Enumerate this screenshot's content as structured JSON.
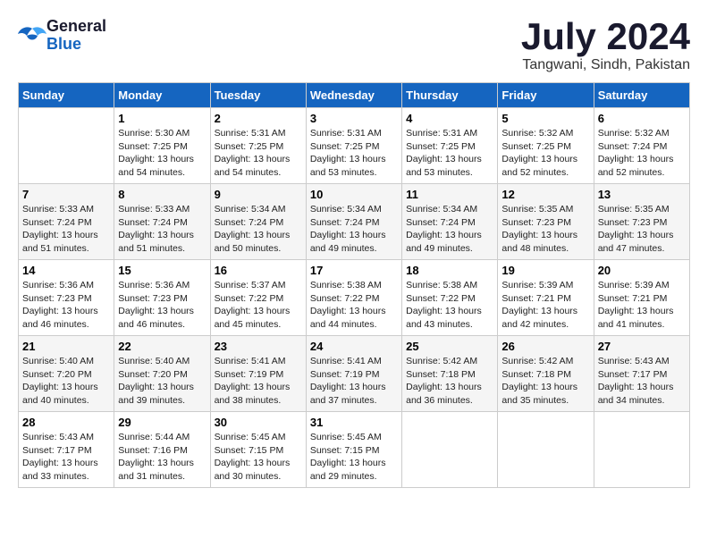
{
  "logo": {
    "line1": "General",
    "line2": "Blue"
  },
  "title": "July 2024",
  "location": "Tangwani, Sindh, Pakistan",
  "days_of_week": [
    "Sunday",
    "Monday",
    "Tuesday",
    "Wednesday",
    "Thursday",
    "Friday",
    "Saturday"
  ],
  "weeks": [
    [
      {
        "day": "",
        "sunrise": "",
        "sunset": "",
        "daylight": ""
      },
      {
        "day": "1",
        "sunrise": "Sunrise: 5:30 AM",
        "sunset": "Sunset: 7:25 PM",
        "daylight": "Daylight: 13 hours and 54 minutes."
      },
      {
        "day": "2",
        "sunrise": "Sunrise: 5:31 AM",
        "sunset": "Sunset: 7:25 PM",
        "daylight": "Daylight: 13 hours and 54 minutes."
      },
      {
        "day": "3",
        "sunrise": "Sunrise: 5:31 AM",
        "sunset": "Sunset: 7:25 PM",
        "daylight": "Daylight: 13 hours and 53 minutes."
      },
      {
        "day": "4",
        "sunrise": "Sunrise: 5:31 AM",
        "sunset": "Sunset: 7:25 PM",
        "daylight": "Daylight: 13 hours and 53 minutes."
      },
      {
        "day": "5",
        "sunrise": "Sunrise: 5:32 AM",
        "sunset": "Sunset: 7:25 PM",
        "daylight": "Daylight: 13 hours and 52 minutes."
      },
      {
        "day": "6",
        "sunrise": "Sunrise: 5:32 AM",
        "sunset": "Sunset: 7:24 PM",
        "daylight": "Daylight: 13 hours and 52 minutes."
      }
    ],
    [
      {
        "day": "7",
        "sunrise": "Sunrise: 5:33 AM",
        "sunset": "Sunset: 7:24 PM",
        "daylight": "Daylight: 13 hours and 51 minutes."
      },
      {
        "day": "8",
        "sunrise": "Sunrise: 5:33 AM",
        "sunset": "Sunset: 7:24 PM",
        "daylight": "Daylight: 13 hours and 51 minutes."
      },
      {
        "day": "9",
        "sunrise": "Sunrise: 5:34 AM",
        "sunset": "Sunset: 7:24 PM",
        "daylight": "Daylight: 13 hours and 50 minutes."
      },
      {
        "day": "10",
        "sunrise": "Sunrise: 5:34 AM",
        "sunset": "Sunset: 7:24 PM",
        "daylight": "Daylight: 13 hours and 49 minutes."
      },
      {
        "day": "11",
        "sunrise": "Sunrise: 5:34 AM",
        "sunset": "Sunset: 7:24 PM",
        "daylight": "Daylight: 13 hours and 49 minutes."
      },
      {
        "day": "12",
        "sunrise": "Sunrise: 5:35 AM",
        "sunset": "Sunset: 7:23 PM",
        "daylight": "Daylight: 13 hours and 48 minutes."
      },
      {
        "day": "13",
        "sunrise": "Sunrise: 5:35 AM",
        "sunset": "Sunset: 7:23 PM",
        "daylight": "Daylight: 13 hours and 47 minutes."
      }
    ],
    [
      {
        "day": "14",
        "sunrise": "Sunrise: 5:36 AM",
        "sunset": "Sunset: 7:23 PM",
        "daylight": "Daylight: 13 hours and 46 minutes."
      },
      {
        "day": "15",
        "sunrise": "Sunrise: 5:36 AM",
        "sunset": "Sunset: 7:23 PM",
        "daylight": "Daylight: 13 hours and 46 minutes."
      },
      {
        "day": "16",
        "sunrise": "Sunrise: 5:37 AM",
        "sunset": "Sunset: 7:22 PM",
        "daylight": "Daylight: 13 hours and 45 minutes."
      },
      {
        "day": "17",
        "sunrise": "Sunrise: 5:38 AM",
        "sunset": "Sunset: 7:22 PM",
        "daylight": "Daylight: 13 hours and 44 minutes."
      },
      {
        "day": "18",
        "sunrise": "Sunrise: 5:38 AM",
        "sunset": "Sunset: 7:22 PM",
        "daylight": "Daylight: 13 hours and 43 minutes."
      },
      {
        "day": "19",
        "sunrise": "Sunrise: 5:39 AM",
        "sunset": "Sunset: 7:21 PM",
        "daylight": "Daylight: 13 hours and 42 minutes."
      },
      {
        "day": "20",
        "sunrise": "Sunrise: 5:39 AM",
        "sunset": "Sunset: 7:21 PM",
        "daylight": "Daylight: 13 hours and 41 minutes."
      }
    ],
    [
      {
        "day": "21",
        "sunrise": "Sunrise: 5:40 AM",
        "sunset": "Sunset: 7:20 PM",
        "daylight": "Daylight: 13 hours and 40 minutes."
      },
      {
        "day": "22",
        "sunrise": "Sunrise: 5:40 AM",
        "sunset": "Sunset: 7:20 PM",
        "daylight": "Daylight: 13 hours and 39 minutes."
      },
      {
        "day": "23",
        "sunrise": "Sunrise: 5:41 AM",
        "sunset": "Sunset: 7:19 PM",
        "daylight": "Daylight: 13 hours and 38 minutes."
      },
      {
        "day": "24",
        "sunrise": "Sunrise: 5:41 AM",
        "sunset": "Sunset: 7:19 PM",
        "daylight": "Daylight: 13 hours and 37 minutes."
      },
      {
        "day": "25",
        "sunrise": "Sunrise: 5:42 AM",
        "sunset": "Sunset: 7:18 PM",
        "daylight": "Daylight: 13 hours and 36 minutes."
      },
      {
        "day": "26",
        "sunrise": "Sunrise: 5:42 AM",
        "sunset": "Sunset: 7:18 PM",
        "daylight": "Daylight: 13 hours and 35 minutes."
      },
      {
        "day": "27",
        "sunrise": "Sunrise: 5:43 AM",
        "sunset": "Sunset: 7:17 PM",
        "daylight": "Daylight: 13 hours and 34 minutes."
      }
    ],
    [
      {
        "day": "28",
        "sunrise": "Sunrise: 5:43 AM",
        "sunset": "Sunset: 7:17 PM",
        "daylight": "Daylight: 13 hours and 33 minutes."
      },
      {
        "day": "29",
        "sunrise": "Sunrise: 5:44 AM",
        "sunset": "Sunset: 7:16 PM",
        "daylight": "Daylight: 13 hours and 31 minutes."
      },
      {
        "day": "30",
        "sunrise": "Sunrise: 5:45 AM",
        "sunset": "Sunset: 7:15 PM",
        "daylight": "Daylight: 13 hours and 30 minutes."
      },
      {
        "day": "31",
        "sunrise": "Sunrise: 5:45 AM",
        "sunset": "Sunset: 7:15 PM",
        "daylight": "Daylight: 13 hours and 29 minutes."
      },
      {
        "day": "",
        "sunrise": "",
        "sunset": "",
        "daylight": ""
      },
      {
        "day": "",
        "sunrise": "",
        "sunset": "",
        "daylight": ""
      },
      {
        "day": "",
        "sunrise": "",
        "sunset": "",
        "daylight": ""
      }
    ]
  ]
}
